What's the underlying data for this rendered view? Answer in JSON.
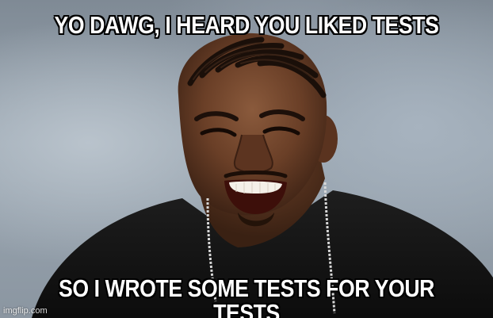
{
  "meme": {
    "top_text": "YO DAWG, I HEARD YOU LIKED TESTS",
    "bottom_text": "SO I WROTE SOME TESTS FOR YOUR TESTS",
    "watermark": "imgflip.com"
  },
  "colors": {
    "caption_fill": "#ffffff",
    "caption_outline": "#000000",
    "backdrop": "#9aa6b1",
    "shirt": "#141414"
  }
}
